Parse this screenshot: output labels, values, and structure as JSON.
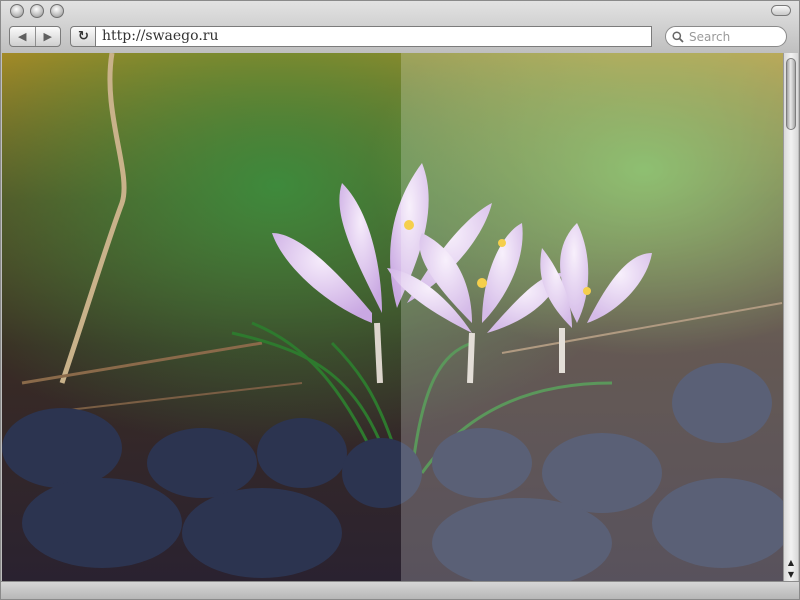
{
  "window": {
    "controls": [
      "close-light",
      "minimize-light",
      "zoom-light"
    ]
  },
  "toolbar": {
    "back_icon": "back-arrow-icon",
    "forward_icon": "forward-arrow-icon",
    "reload_icon": "reload-icon",
    "url": "http://swaego.ru",
    "search_placeholder": "Search",
    "search_icon": "magnifier-icon"
  },
  "content": {
    "image_description_icon": "photo-crocus-flowers"
  },
  "scrollbar": {
    "up_icon": "scroll-up-icon",
    "down_icon": "scroll-down-icon"
  }
}
